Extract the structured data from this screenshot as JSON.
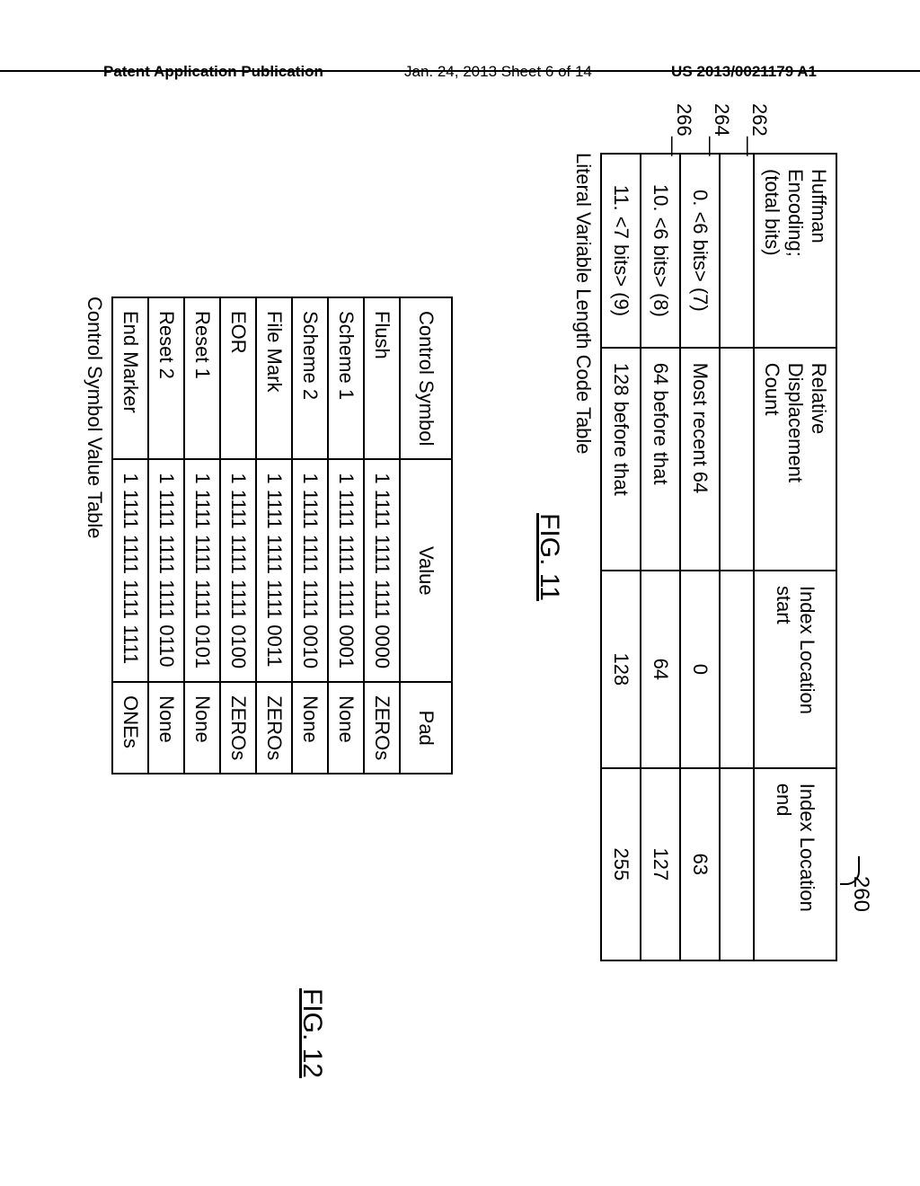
{
  "header": {
    "left": "Patent Application Publication",
    "mid": "Jan. 24, 2013  Sheet 6 of 14",
    "right": "US 2013/0021179 A1"
  },
  "fig11": {
    "ref_main": "260",
    "row_refs": [
      "262",
      "264",
      "266"
    ],
    "headers": [
      "Huffman Encoding; (total bits)",
      "Relative Displacement Count",
      "Index Location start",
      "Index Location end"
    ],
    "h1a": "Huffman Encoding;",
    "h1b": "(total bits)",
    "h2a": "Relative Displacement",
    "h2b": "Count",
    "h3": "Index Location start",
    "h4": "Index Location end",
    "rows": [
      {
        "c0": "0. <6 bits> (7)",
        "c1": "Most recent 64",
        "c2": "0",
        "c3": "63"
      },
      {
        "c0": "10. <6 bits> (8)",
        "c1": "64 before that",
        "c2": "64",
        "c3": "127"
      },
      {
        "c0": "11. <7 bits> (9)",
        "c1": "128 before that",
        "c2": "128",
        "c3": "255"
      }
    ],
    "caption": "Literal Variable Length Code Table",
    "label": "FIG. 11"
  },
  "fig12": {
    "headers": [
      "Control Symbol",
      "Value",
      "Pad"
    ],
    "rows": [
      {
        "c0": "Flush",
        "c1": "1 1111 1111 1111 0000",
        "c2": "ZEROs"
      },
      {
        "c0": "Scheme 1",
        "c1": "1 1111 1111 1111 0001",
        "c2": "None"
      },
      {
        "c0": "Scheme 2",
        "c1": "1 1111 1111 1111 0010",
        "c2": "None"
      },
      {
        "c0": "File Mark",
        "c1": "1 1111 1111 1111 0011",
        "c2": "ZEROs"
      },
      {
        "c0": "EOR",
        "c1": "1 1111 1111 1111 0100",
        "c2": "ZEROs"
      },
      {
        "c0": "Reset 1",
        "c1": "1 1111 1111 1111 0101",
        "c2": "None"
      },
      {
        "c0": "Reset 2",
        "c1": "1 1111 1111 1111 0110",
        "c2": "None"
      },
      {
        "c0": "End Marker",
        "c1": "1 1111 1111 1111 1111",
        "c2": "ONEs"
      }
    ],
    "caption": "Control Symbol Value Table",
    "label": "FIG. 12"
  },
  "chart_data": [
    {
      "type": "table",
      "title": "Literal Variable Length Code Table (FIG. 11, ref 260)",
      "columns": [
        "Huffman Encoding; (total bits)",
        "Relative Displacement Count",
        "Index Location start",
        "Index Location end"
      ],
      "rows": [
        [
          "0. <6 bits> (7)",
          "Most recent 64",
          0,
          63
        ],
        [
          "10. <6 bits> (8)",
          "64 before that",
          64,
          127
        ],
        [
          "11. <7 bits> (9)",
          "128 before that",
          128,
          255
        ]
      ],
      "row_refs": [
        262,
        264,
        266
      ]
    },
    {
      "type": "table",
      "title": "Control Symbol Value Table (FIG. 12)",
      "columns": [
        "Control Symbol",
        "Value",
        "Pad"
      ],
      "rows": [
        [
          "Flush",
          "1 1111 1111 1111 0000",
          "ZEROs"
        ],
        [
          "Scheme 1",
          "1 1111 1111 1111 0001",
          "None"
        ],
        [
          "Scheme 2",
          "1 1111 1111 1111 0010",
          "None"
        ],
        [
          "File Mark",
          "1 1111 1111 1111 0011",
          "ZEROs"
        ],
        [
          "EOR",
          "1 1111 1111 1111 0100",
          "ZEROs"
        ],
        [
          "Reset 1",
          "1 1111 1111 1111 0101",
          "None"
        ],
        [
          "Reset 2",
          "1 1111 1111 1111 0110",
          "None"
        ],
        [
          "End Marker",
          "1 1111 1111 1111 1111",
          "ONEs"
        ]
      ]
    }
  ]
}
